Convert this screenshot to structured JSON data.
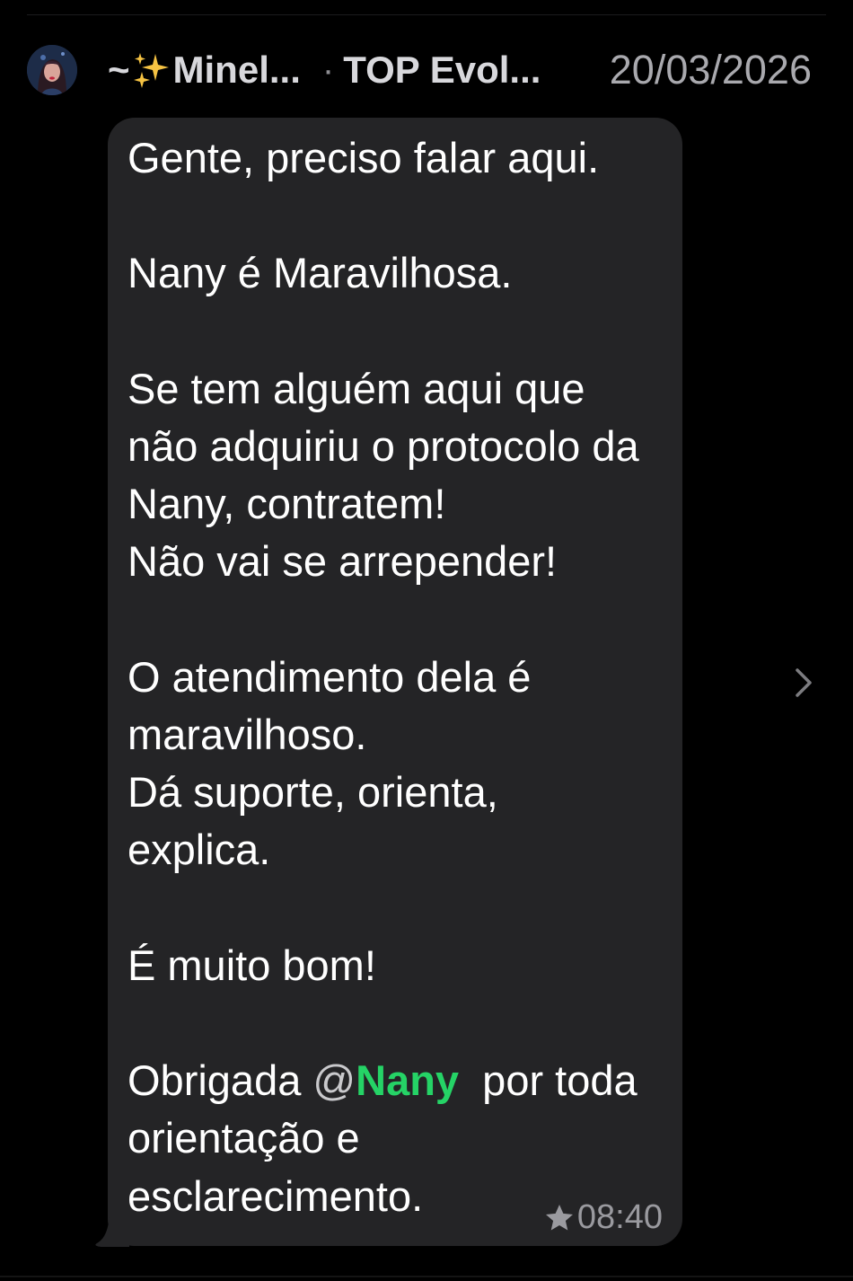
{
  "header": {
    "sender_prefix": "~",
    "sender_name": "Minel...",
    "separator": "·",
    "group_name": "TOP Evol...",
    "date": "20/03/2026",
    "avatar_icon": "profile-photo",
    "sparkle_icon": "sparkles-emoji"
  },
  "message": {
    "p1": "Gente, preciso falar aqui.",
    "p2": "Nany é Maravilhosa.",
    "p3": "Se tem alguém aqui que\nnão adquiriu o protocolo da\nNany, contratem!\nNão vai se arrepender!",
    "p4": "O atendimento dela é\nmaravilhoso.\nDá suporte, orienta,\nexplica.",
    "p5": "É muito bom!",
    "p6_before": "Obrigada ",
    "mention_at": "@",
    "mention_name": "Nany",
    "p6_after": "  por toda\norientação e\nesclarecimento.",
    "time": "08:40",
    "star_icon": "star-icon",
    "chevron_icon": "chevron-right-icon"
  },
  "colors": {
    "background": "#000000",
    "bubble": "#242426",
    "mention": "#25d366",
    "meta_text": "#9a9a9f"
  }
}
